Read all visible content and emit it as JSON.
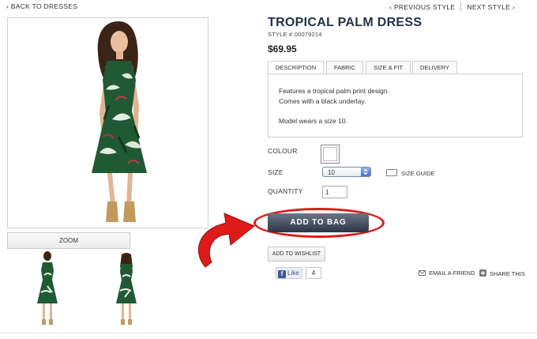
{
  "nav": {
    "back": "‹ BACK TO DRESSES",
    "previous": "‹ PREVIOUS STYLE",
    "next": "NEXT STYLE ›"
  },
  "gallery": {
    "zoom_label": "ZOOM"
  },
  "product": {
    "title": "TROPICAL PALM DRESS",
    "style": "STYLE # 00079214",
    "price": "$69.95"
  },
  "tabs": [
    {
      "label": "DESCRIPTION",
      "active": true
    },
    {
      "label": "FABRIC",
      "active": false
    },
    {
      "label": "SIZE & FIT",
      "active": false
    },
    {
      "label": "DELIVERY",
      "active": false
    }
  ],
  "description": {
    "line1": "Features a tropical palm print design.",
    "line2": "Comes with a black underlay.",
    "line3": "Model wears a size 10."
  },
  "options": {
    "colour_label": "COLOUR",
    "size_label": "SIZE",
    "size_value": "10",
    "size_guide": "SIZE GUIDE",
    "quantity_label": "QUANTITY",
    "quantity_value": "1"
  },
  "actions": {
    "add_to_bag": "ADD TO BAG",
    "add_to_wishlist": "ADD TO WISHLIST"
  },
  "social": {
    "like": "Like",
    "like_count": "4",
    "email": "EMAIL A FRIEND",
    "share": "SHARE THIS"
  },
  "colors": {
    "title": "#233247",
    "button": "#2b3547",
    "highlight": "#e01919"
  }
}
